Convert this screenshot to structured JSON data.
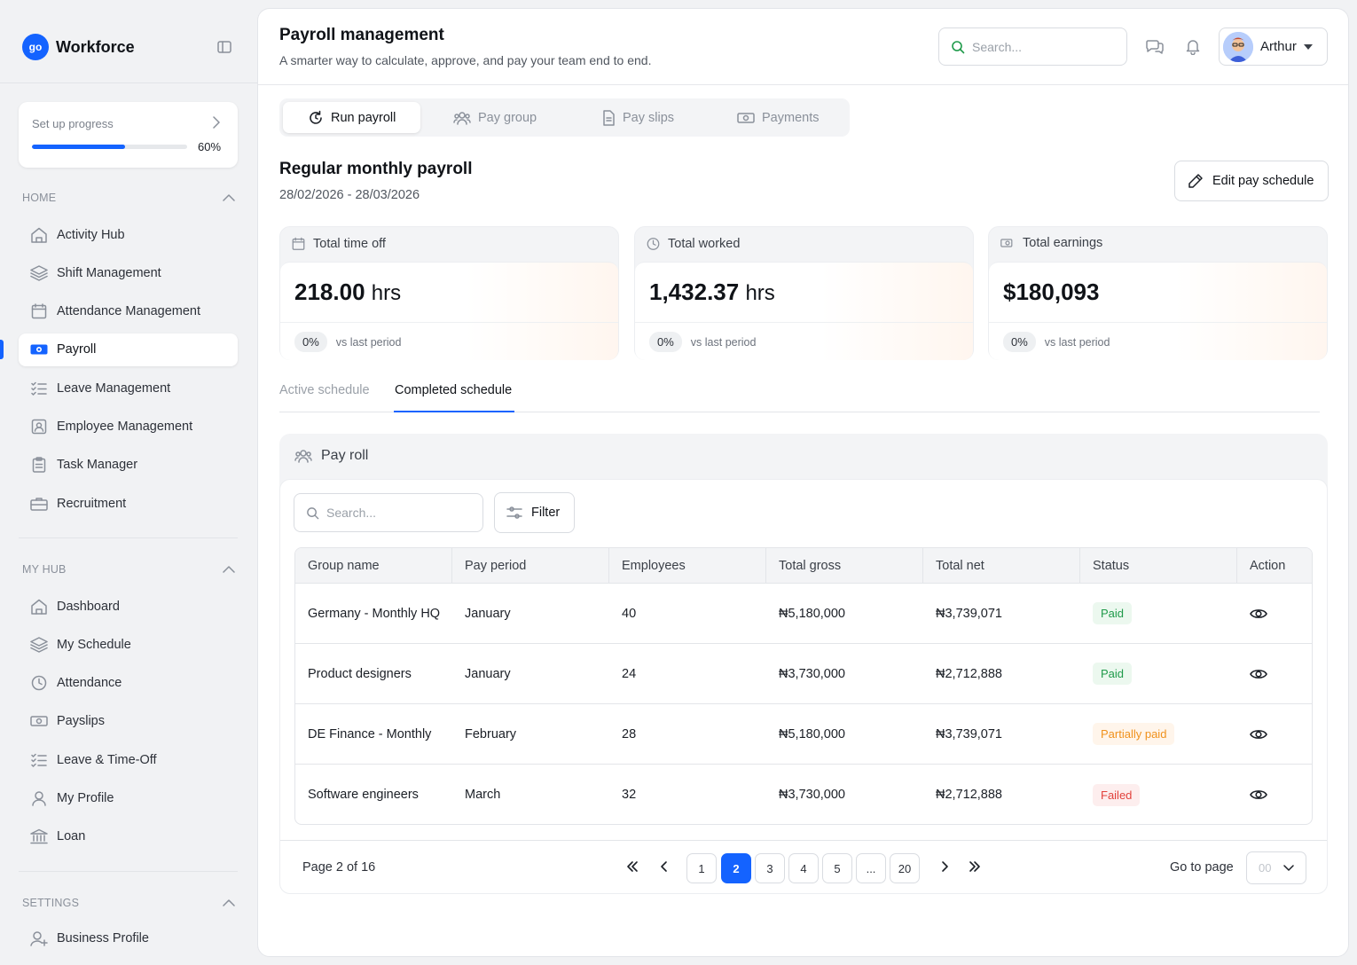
{
  "app": {
    "name": "Workforce",
    "logo_text": "go"
  },
  "progress": {
    "label": "Set up progress",
    "value": 0.6,
    "pct_text": "60%"
  },
  "sections": {
    "home": "HOME",
    "my_hub": "MY HUB",
    "settings": "SETTINGS"
  },
  "nav_home": [
    {
      "label": "Activity Hub",
      "icon": "home-icon"
    },
    {
      "label": "Shift Management",
      "icon": "layers-icon"
    },
    {
      "label": "Attendance Management",
      "icon": "calendar-icon"
    },
    {
      "label": "Payroll",
      "icon": "money-icon"
    },
    {
      "label": "Leave Management",
      "icon": "list-check-icon"
    },
    {
      "label": "Employee Management",
      "icon": "id-card-icon"
    },
    {
      "label": "Task Manager",
      "icon": "clipboard-icon"
    },
    {
      "label": "Recruitment",
      "icon": "briefcase-icon"
    }
  ],
  "nav_hub": [
    {
      "label": "Dashboard",
      "icon": "home-icon"
    },
    {
      "label": "My Schedule",
      "icon": "layers-icon"
    },
    {
      "label": "Attendance",
      "icon": "clock-icon"
    },
    {
      "label": "Payslips",
      "icon": "money-icon"
    },
    {
      "label": "Leave & Time-Off",
      "icon": "list-check-icon"
    },
    {
      "label": "My Profile",
      "icon": "user-icon"
    },
    {
      "label": "Loan",
      "icon": "bank-icon"
    }
  ],
  "nav_settings": [
    {
      "label": "Business Profile",
      "icon": "user-plus-icon"
    }
  ],
  "header": {
    "title": "Payroll management",
    "subtitle": "A smarter way to calculate, approve, and pay your team end to end.",
    "search_placeholder": "Search...",
    "user": "Arthur"
  },
  "tabs": [
    "Run payroll",
    "Pay group",
    "Pay slips",
    "Payments"
  ],
  "schedule": {
    "title": "Regular monthly payroll",
    "dates": "28/02/2026 - 28/03/2026",
    "edit_label": "Edit pay schedule"
  },
  "stats": [
    {
      "label": "Total time off",
      "value": "218.00",
      "unit": "hrs",
      "change": "0%",
      "vs": "vs last period",
      "icon": "calendar-icon"
    },
    {
      "label": "Total worked",
      "value": "1,432.37",
      "unit": "hrs",
      "change": "0%",
      "vs": "vs last period",
      "icon": "clock-icon"
    },
    {
      "label": "Total earnings",
      "value": "$180,093",
      "unit": "",
      "change": "0%",
      "vs": "vs last period",
      "icon": "money-icon"
    }
  ],
  "sub_tabs": [
    "Active schedule",
    "Completed schedule"
  ],
  "payroll_table": {
    "title": "Pay roll",
    "search_placeholder": "Search...",
    "filter_label": "Filter",
    "columns": [
      "Group name",
      "Pay period",
      "Employees",
      "Total gross",
      "Total net",
      "Status",
      "Action"
    ],
    "rows": [
      {
        "group": "Germany - Monthly HQ",
        "period": "January",
        "employees": "40",
        "gross": "₦5,180,000",
        "net": "₦3,739,071",
        "status": "Paid",
        "status_kind": "paid"
      },
      {
        "group": "Product designers",
        "period": "January",
        "employees": "24",
        "gross": "₦3,730,000",
        "net": "₦2,712,888",
        "status": "Paid",
        "status_kind": "paid"
      },
      {
        "group": "DE Finance - Monthly",
        "period": "February",
        "employees": "28",
        "gross": "₦5,180,000",
        "net": "₦3,739,071",
        "status": "Partially paid",
        "status_kind": "partial"
      },
      {
        "group": "Software engineers",
        "period": "March",
        "employees": "32",
        "gross": "₦3,730,000",
        "net": "₦2,712,888",
        "status": "Failed",
        "status_kind": "failed"
      }
    ]
  },
  "pagination": {
    "info": "Page 2 of 16",
    "pages": [
      "1",
      "2",
      "3",
      "4",
      "5",
      "...",
      "20"
    ],
    "current": "2",
    "goto_label": "Go to page",
    "goto_value": "00"
  }
}
